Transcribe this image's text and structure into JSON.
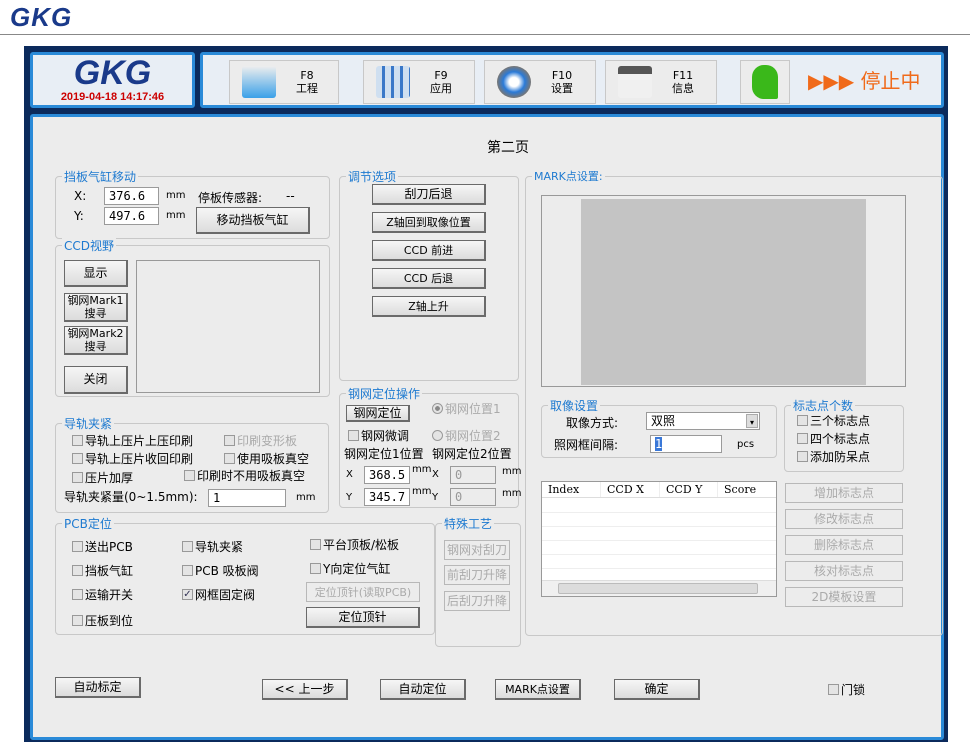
{
  "header": {
    "logo": "GKG"
  },
  "logo_panel": {
    "logo": "GKG",
    "datetime": "2019-04-18 14:17:46"
  },
  "toolbar": {
    "buttons": [
      {
        "key": "F8",
        "label": "工程",
        "icon": "folder-icon"
      },
      {
        "key": "F9",
        "label": "应用",
        "icon": "app-window-icon"
      },
      {
        "key": "F10",
        "label": "设置",
        "icon": "gear-icon"
      },
      {
        "key": "F11",
        "label": "信息",
        "icon": "info-card-icon"
      }
    ],
    "status": "▶▶▶ 停止中",
    "colors": {
      "status": "#f06a1a",
      "accent": "#2a8ad8"
    }
  },
  "page_title": "第二页",
  "baffle": {
    "title": "挡板气缸移动",
    "x_label": "X:",
    "x_value": "376.6",
    "y_label": "Y:",
    "y_value": "497.6",
    "unit": "mm",
    "sensor_label": "停板传感器:",
    "sensor_value": "--",
    "move_button": "移动挡板气缸"
  },
  "ccd": {
    "title": "CCD视野",
    "show": "显示",
    "mark1_a": "钢网Mark1",
    "mark1_b": "搜寻",
    "mark2_a": "钢网Mark2",
    "mark2_b": "搜寻",
    "close": "关闭"
  },
  "adjust": {
    "title": "调节选项",
    "buttons": [
      "刮刀后退",
      "Z轴回到取像位置",
      "CCD 前进",
      "CCD 后退",
      "Z轴上升"
    ]
  },
  "stencil": {
    "title": "钢网定位操作",
    "locate": "钢网定位",
    "pos1": "钢网位置1",
    "pos2": "钢网位置2",
    "fine": "钢网微调",
    "pos1_title": "钢网定位1位置",
    "pos2_title": "钢网定位2位置",
    "x": "X",
    "y": "Y",
    "x1": "368.5",
    "y1": "345.7",
    "x2": "0",
    "y2": "0",
    "unit": "mm"
  },
  "rail": {
    "title": "导轨夹紧",
    "items": [
      "导轨上压片上压印刷",
      "印刷变形板",
      "导轨上压片收回印刷",
      "使用吸板真空",
      "压片加厚",
      "印刷时不用吸板真空"
    ],
    "clamp_label": "导轨夹紧量(0~1.5mm):",
    "clamp_value": "1",
    "unit": "mm"
  },
  "pcb": {
    "title": "PCB定位",
    "items": [
      "送出PCB",
      "导轨夹紧",
      "平台顶板/松板",
      "挡板气缸",
      "PCB 吸板阀",
      "Y向定位气缸",
      "运输开关",
      "网框固定阀",
      "压板到位"
    ],
    "pin_read": "定位顶针(读取PCB)",
    "pin": "定位顶针"
  },
  "special": {
    "title": "特殊工艺",
    "buttons": [
      "钢网对刮刀",
      "前刮刀升降",
      "后刮刀升降"
    ]
  },
  "mark": {
    "title": "MARK点设置:"
  },
  "capture": {
    "title": "取像设置",
    "mode_label": "取像方式:",
    "mode_value": "双照",
    "interval_label": "照网框间隔:",
    "interval_value": "1",
    "unit": "pcs"
  },
  "marks_count": {
    "title": "标志点个数",
    "items": [
      "三个标志点",
      "四个标志点",
      "添加防呆点"
    ]
  },
  "table": {
    "columns": [
      "Index",
      "CCD X",
      "CCD Y",
      "Score"
    ]
  },
  "mark_buttons": [
    "增加标志点",
    "修改标志点",
    "删除标志点",
    "核对标志点",
    "2D模板设置"
  ],
  "footer": {
    "auto_calib": "自动标定",
    "prev": "<< 上一步",
    "auto_locate": "自动定位",
    "mark_set": "MARK点设置",
    "ok": "确定",
    "door": "门锁"
  }
}
